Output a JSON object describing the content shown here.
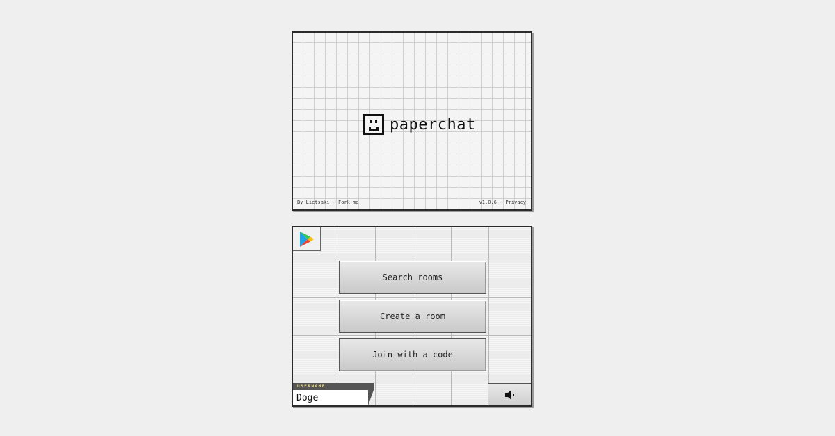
{
  "app": {
    "logo_text": "paperchat",
    "credit": "By Lietsaki - Fork me!",
    "version_privacy": "v1.0.6 - Privacy"
  },
  "menu": {
    "search_label": "Search rooms",
    "create_label": "Create a room",
    "join_label": "Join with a code"
  },
  "username": {
    "label": "USERNAME",
    "value": "Doge"
  },
  "icons": {
    "store": "google-play-icon",
    "sound": "speaker-icon",
    "logo": "smiley-face-icon"
  },
  "colors": {
    "background": "#efefef",
    "border": "#2b2b2b",
    "label_bar": "#555555",
    "label_text": "#e8d98a"
  }
}
